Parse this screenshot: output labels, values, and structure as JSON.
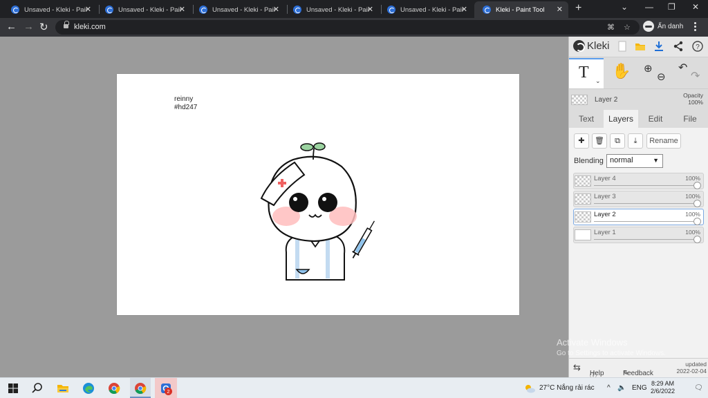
{
  "browser": {
    "tabs": [
      {
        "title": "Unsaved - Kleki - Paint",
        "active": false
      },
      {
        "title": "Unsaved - Kleki - Paint",
        "active": false
      },
      {
        "title": "Unsaved - Kleki - Paint",
        "active": false
      },
      {
        "title": "Unsaved - Kleki - Paint",
        "active": false
      },
      {
        "title": "Unsaved - Kleki - Paint",
        "active": false
      },
      {
        "title": "Kleki - Paint Tool",
        "active": true
      }
    ],
    "url": "kleki.com",
    "profile_label": "Ẩn danh"
  },
  "canvas": {
    "signature_line1": "reinny",
    "signature_line2": "#hd247"
  },
  "kleki": {
    "logo_text": "Kleki",
    "current_layer": "Layer 2",
    "opacity_label": "Opacity",
    "opacity_value": "100%",
    "panel_tabs": [
      {
        "label": "Text",
        "active": false
      },
      {
        "label": "Layers",
        "active": true
      },
      {
        "label": "Edit",
        "active": false
      },
      {
        "label": "File",
        "active": false
      }
    ],
    "rename_label": "Rename",
    "blending_label": "Blending",
    "blending_value": "normal",
    "layers": [
      {
        "name": "Layer 4",
        "opacity": "100%",
        "selected": false
      },
      {
        "name": "Layer 3",
        "opacity": "100%",
        "selected": false
      },
      {
        "name": "Layer 2",
        "opacity": "100%",
        "selected": true
      },
      {
        "name": "Layer 1",
        "opacity": "100%",
        "selected": false
      }
    ],
    "help_label": "Help",
    "feedback_label": "Feedback",
    "updated_label": "updated",
    "updated_date": "2022-02-04"
  },
  "watermark": {
    "line1": "Activate Windows",
    "line2": "Go to Settings to activate Windows."
  },
  "taskbar": {
    "weather": "27°C  Nắng rải rác",
    "language": "ENG",
    "time": "8:29 AM",
    "date": "2/6/2022",
    "badge_count": "2"
  },
  "colors": {
    "accent": "#5b9ded",
    "tab_bar": "#202124",
    "toolbar": "#35363a",
    "workspace": "#9b9b9b"
  }
}
